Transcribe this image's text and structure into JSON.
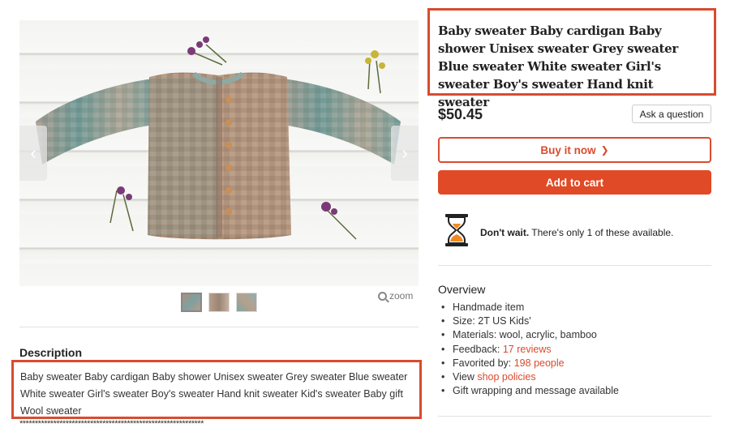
{
  "listing": {
    "title": "Baby sweater Baby cardigan Baby shower Unisex sweater Grey sweater Blue sweater White sweater Girl's sweater Boy's sweater Hand knit sweater",
    "price": "$50.45",
    "ask_question_label": "Ask a question",
    "buy_now_label": "Buy it now",
    "add_to_cart_label": "Add to cart",
    "stock_bold": "Don't wait.",
    "stock_rest": " There's only 1 of these available."
  },
  "gallery": {
    "zoom_label": "zoom",
    "thumbnail_count": 3
  },
  "overview": {
    "heading": "Overview",
    "items": [
      {
        "text": "Handmade item"
      },
      {
        "text": "Size: 2T US Kids'"
      },
      {
        "text": "Materials: wool, acrylic, bamboo"
      },
      {
        "prefix": "Feedback: ",
        "link": "17 reviews"
      },
      {
        "prefix": "Favorited by: ",
        "link": "198 people"
      },
      {
        "prefix": "View ",
        "link": "shop policies"
      },
      {
        "text": "Gift wrapping and message available"
      }
    ]
  },
  "description": {
    "heading": "Description",
    "text": "Baby sweater Baby cardigan Baby shower Unisex sweater Grey sweater Blue sweater White sweater Girl's sweater Boy's sweater Hand knit sweater Kid's sweater Baby gift Wool sweater",
    "separator": "************************************************************"
  },
  "colors": {
    "accent": "#d94b2e",
    "button_fill": "#e04a26",
    "highlight_border": "#d94b2e"
  },
  "icons": [
    "chevron-left-icon",
    "chevron-right-icon",
    "magnifier-icon",
    "hourglass-icon"
  ]
}
